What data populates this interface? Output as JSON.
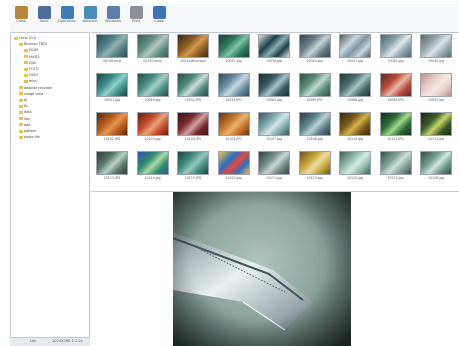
{
  "toolbar": {
    "buttons": [
      {
        "label": "Close",
        "icon": "power-icon",
        "color": "#b6873d"
      },
      {
        "label": "Save",
        "icon": "save-icon",
        "color": "#4c6e9c"
      },
      {
        "label": "Operation",
        "icon": "operation-icon",
        "color": "#3f7cb5"
      },
      {
        "label": "Network",
        "icon": "network-icon",
        "color": "#4a8ab8"
      },
      {
        "label": "Windows",
        "icon": "windows-icon",
        "color": "#5d7ea8"
      },
      {
        "label": "Print",
        "icon": "print-icon",
        "color": "#8a8f98"
      },
      {
        "label": "Close",
        "icon": "close-x-icon",
        "color": "#3d74b6"
      }
    ]
  },
  "sidebar": {
    "items": [
      {
        "label": "Local (D:\\)",
        "indent": 0
      },
      {
        "label": "Bluecap TBDI",
        "indent": 1
      },
      {
        "label": "DCIM",
        "indent": 2
      },
      {
        "label": "HI4D3",
        "indent": 2
      },
      {
        "label": "DJI0",
        "indent": 2
      },
      {
        "label": "FOTO",
        "indent": 2
      },
      {
        "label": "DiGH",
        "indent": 2
      },
      {
        "label": "misc",
        "indent": 2
      },
      {
        "label": "adapter recorder",
        "indent": 1
      },
      {
        "label": "usage view",
        "indent": 1
      },
      {
        "label": "Ai",
        "indent": 1
      },
      {
        "label": "fix",
        "indent": 1
      },
      {
        "label": "data",
        "indent": 1
      },
      {
        "label": "doc",
        "indent": 1
      },
      {
        "label": "add",
        "indent": 1
      },
      {
        "label": "pattern",
        "indent": 1
      },
      {
        "label": "paste file",
        "indent": 1
      }
    ],
    "footer": {
      "left": "Len",
      "right": "1024X768  1:1.2s"
    }
  },
  "gallery": {
    "rows": [
      [
        {
          "caption": "00149.bmp",
          "colors": [
            "#4f7f86",
            "#8fb1b0",
            "#2d4c55"
          ]
        },
        {
          "caption": "00150.bmp",
          "colors": [
            "#5f8f83",
            "#b2c9c0",
            "#3c5c56"
          ]
        },
        {
          "caption": "10034-BluecapS",
          "colors": [
            "#8a5a22",
            "#d39a4a",
            "#3c2a16"
          ]
        },
        {
          "caption": "10037.jpg",
          "colors": [
            "#2e7b5e",
            "#7fc2a4",
            "#1d3e33"
          ]
        },
        {
          "caption": "10039.jpg",
          "colors": [
            "#1e3f48",
            "#86aeb2",
            "#d9e6e3"
          ]
        },
        {
          "caption": "10040.jpg",
          "colors": [
            "#6a7f88",
            "#c5d4d6",
            "#33464d"
          ]
        },
        {
          "caption": "10041.jpg",
          "colors": [
            "#c7d7de",
            "#7e95a0",
            "#4a5d68"
          ]
        },
        {
          "caption": "10044.jpg",
          "colors": [
            "#8aa3ad",
            "#e0e9ec",
            "#4f6670"
          ]
        },
        {
          "caption": "10045.jpg",
          "colors": [
            "#9aa9b0",
            "#d8e2e6",
            "#5a6a72"
          ]
        }
      ],
      [
        {
          "caption": "10047.jpg",
          "colors": [
            "#3c8c8a",
            "#8fd0c8",
            "#1f4645"
          ]
        },
        {
          "caption": "10049.jpg",
          "colors": [
            "#4c8f84",
            "#a4d1c6",
            "#274842"
          ]
        },
        {
          "caption": "10052.JPG",
          "colors": [
            "#4f8a7d",
            "#c8ddd6",
            "#2a4a43"
          ]
        },
        {
          "caption": "10054.JPG",
          "colors": [
            "#6b8fa3",
            "#c6d8e2",
            "#32495a"
          ]
        },
        {
          "caption": "10063.jpg",
          "colors": [
            "#3a5a66",
            "#a9c3c8",
            "#1c2f35"
          ]
        },
        {
          "caption": "10065.JPG",
          "colors": [
            "#5c8c7b",
            "#bcd8cb",
            "#2f4c41"
          ]
        },
        {
          "caption": "10086.jpg",
          "colors": [
            "#4a6d6c",
            "#a8c4c0",
            "#233736"
          ]
        },
        {
          "caption": "10085.JPG",
          "colors": [
            "#b84a3c",
            "#e7b8a6",
            "#5a2a20"
          ]
        },
        {
          "caption": "10092.jpg",
          "colors": [
            "#e7cfc9",
            "#f4e7e2",
            "#b98e85"
          ]
        }
      ],
      [
        {
          "caption": "10102.JPG",
          "colors": [
            "#b45a1c",
            "#e39450",
            "#5a2c0e"
          ]
        },
        {
          "caption": "10103.jpg",
          "colors": [
            "#c24a2a",
            "#e7a07a",
            "#5f2415"
          ]
        },
        {
          "caption": "10104.JPG",
          "colors": [
            "#7a2a2e",
            "#d0a0a0",
            "#3a1418"
          ]
        },
        {
          "caption": "10104.JPG",
          "colors": [
            "#c2722c",
            "#eab06a",
            "#5d3412"
          ]
        },
        {
          "caption": "10107.jpg",
          "colors": [
            "#7fa9a9",
            "#d4e6e4",
            "#3d5656"
          ]
        },
        {
          "caption": "10108.jpg",
          "colors": [
            "#5c7f86",
            "#b9d0d3",
            "#2c3e43"
          ]
        },
        {
          "caption": "10110.jpg",
          "colors": [
            "#7a5a1c",
            "#d4b04a",
            "#3a2a0c"
          ]
        },
        {
          "caption": "10111.JPG",
          "colors": [
            "#2d6a3a",
            "#9fd88a",
            "#153319"
          ]
        },
        {
          "caption": "10112.jpg",
          "colors": [
            "#3a5a2a",
            "#c8d46a",
            "#1c2a12"
          ]
        }
      ],
      [
        {
          "caption": "10113.JPG",
          "colors": [
            "#5c7a6c",
            "#b8cfc6",
            "#2d3d35"
          ]
        },
        {
          "caption": "10114.jpg",
          "colors": [
            "#2e8a6a",
            "#a6d9a2",
            "#3a4fb0"
          ]
        },
        {
          "caption": "10115.JPG",
          "colors": [
            "#3f8a7d",
            "#98c9bd",
            "#1f443e"
          ]
        },
        {
          "caption": "10120.jpg",
          "colors": [
            "#2a6fc8",
            "#e8463a",
            "#f2c43a"
          ]
        },
        {
          "caption": "10121.jpg",
          "colors": [
            "#6f8a84",
            "#c6d6d2",
            "#36433f"
          ]
        },
        {
          "caption": "10123.jpg",
          "colors": [
            "#c7a43a",
            "#f0dca0",
            "#6a5420"
          ]
        },
        {
          "caption": "10125.jpg",
          "colors": [
            "#8fb9a9",
            "#d6eae3",
            "#456057"
          ]
        },
        {
          "caption": "10125.jpg",
          "colors": [
            "#7f9f95",
            "#cfe0da",
            "#3e4f4a"
          ]
        },
        {
          "caption": "10126.jpg",
          "colors": [
            "#6f9a8c",
            "#d3e5de",
            "#374c45"
          ]
        }
      ]
    ]
  },
  "preview": {
    "alt": "magnified metal blade preview",
    "colors": {
      "metal_light": "#e9f0ef",
      "metal_mid": "#a9bcc0",
      "metal_dark": "#40545a"
    }
  }
}
